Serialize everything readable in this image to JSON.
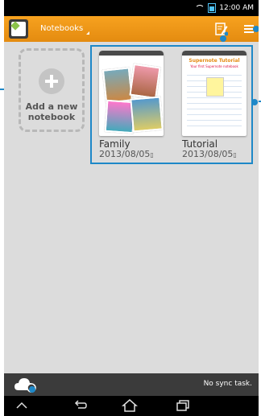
{
  "status": {
    "time": "12:00 AM"
  },
  "actionbar": {
    "notebooks_label": "Notebooks"
  },
  "add_tile": {
    "label": "Add a new notebook"
  },
  "notebooks": [
    {
      "name": "Family",
      "date": "2013/08/05",
      "date_suffix": "▯"
    },
    {
      "name": "Tutorial",
      "date": "2013/08/05",
      "date_suffix": "▯",
      "cover_title": "Supernote Tutorial",
      "cover_subtitle": "Your first Supernote notebook"
    }
  ],
  "bottombar": {
    "sync_status": "No sync task."
  },
  "colors": {
    "accent": "#f39c12",
    "highlight": "#1e88c8"
  },
  "icons": [
    "app-icon",
    "chevron-down-icon",
    "new-note-icon",
    "menu-icon",
    "cloud-settings-icon",
    "back-icon",
    "home-icon",
    "recent-apps-icon",
    "hide-icon",
    "wifi-icon",
    "battery-icon"
  ]
}
